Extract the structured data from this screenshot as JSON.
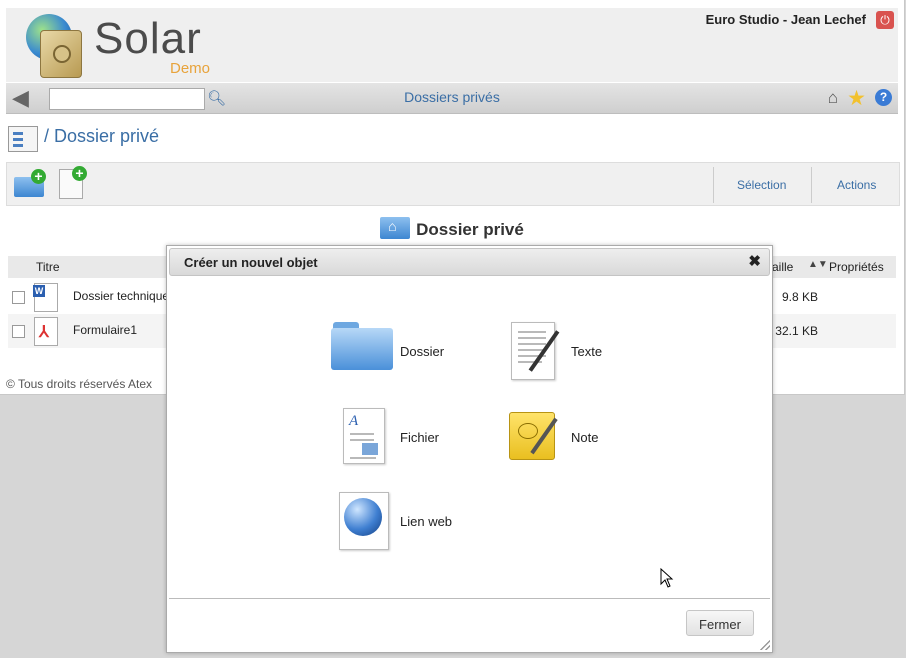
{
  "header": {
    "logo_text": "Solar",
    "logo_sub": "Demo",
    "user": "Euro Studio - Jean Lechef"
  },
  "navbar": {
    "search_value": "",
    "title": "Dossiers privés"
  },
  "breadcrumb": {
    "text": "/ Dossier privé"
  },
  "toolbar": {
    "selection_label": "Sélection",
    "actions_label": "Actions"
  },
  "folder_title": "Dossier privé",
  "table": {
    "col_title": "Titre",
    "col_size": "aille",
    "col_props": "Propriétés",
    "rows": [
      {
        "name": "Dossier technique",
        "size": "9.8 KB",
        "type": "word"
      },
      {
        "name": "Formulaire1",
        "size": "32.1 KB",
        "type": "pdf"
      }
    ]
  },
  "footer": "© Tous droits réservés Atex",
  "dialog": {
    "title": "Créer un nouvel objet",
    "close_symbol": "✖",
    "items": [
      {
        "label": "Dossier",
        "icon": "folder-icon"
      },
      {
        "label": "Texte",
        "icon": "text-document-icon"
      },
      {
        "label": "Fichier",
        "icon": "file-icon"
      },
      {
        "label": "Note",
        "icon": "note-icon"
      },
      {
        "label": "Lien web",
        "icon": "web-link-icon"
      }
    ],
    "close_button": "Fermer"
  }
}
